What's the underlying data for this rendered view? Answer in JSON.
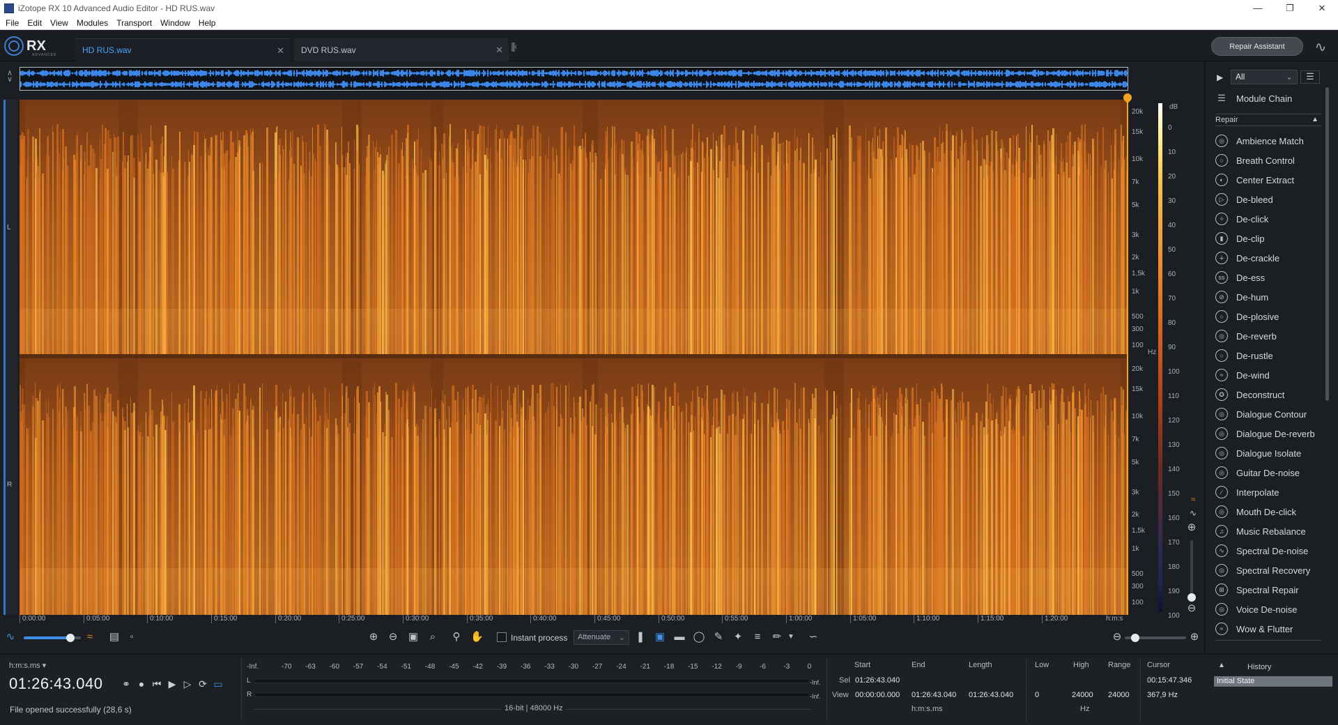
{
  "window": {
    "title": "iZotope RX 10 Advanced Audio Editor - HD RUS.wav"
  },
  "menu": [
    "File",
    "Edit",
    "View",
    "Modules",
    "Transport",
    "Window",
    "Help"
  ],
  "logo": {
    "text": "RX",
    "sub": "ADVANCED"
  },
  "tabs": [
    {
      "label": "HD RUS.wav",
      "active": true
    },
    {
      "label": "DVD RUS.wav",
      "active": false
    }
  ],
  "repair_assistant_label": "Repair Assistant",
  "channels": {
    "left": "L",
    "right": "R"
  },
  "freq_ticks": [
    "20k",
    "15k",
    "10k",
    "7k",
    "5k",
    "3k",
    "2k",
    "1,5k",
    "1k",
    "500",
    "300",
    "100"
  ],
  "freq_unit": "Hz",
  "db_unit": "dB",
  "db_ticks": [
    "0",
    "10",
    "20",
    "30",
    "40",
    "50",
    "60",
    "70",
    "80",
    "90",
    "100",
    "110",
    "120",
    "130",
    "140",
    "150",
    "160",
    "170",
    "180",
    "190",
    "100"
  ],
  "time_ticks": [
    "0:00:00",
    "0:05:00",
    "0:10:00",
    "0:15:00",
    "0:20:00",
    "0:25:00",
    "0:30:00",
    "0:35:00",
    "0:40:00",
    "0:45:00",
    "0:50:00",
    "0:55:00",
    "1:00:00",
    "1:05:00",
    "1:10:00",
    "1:15:00",
    "1:20:00"
  ],
  "time_unit": "h:m:s",
  "toolbar": {
    "instant_process_label": "Instant process",
    "attenuate_label": "Attenuate",
    "volume_level": 0.82,
    "zoom_level": 0.1
  },
  "transport": {
    "time_format": "h:m:s.ms",
    "timecode": "01:26:43.040",
    "status": "File opened successfully (28,6 s)"
  },
  "meter": {
    "scale": [
      "-Inf.",
      "-70",
      "-63",
      "-60",
      "-57",
      "-54",
      "-51",
      "-48",
      "-45",
      "-42",
      "-39",
      "-36",
      "-33",
      "-30",
      "-27",
      "-24",
      "-21",
      "-18",
      "-15",
      "-12",
      "-9",
      "-6",
      "-3",
      "0"
    ],
    "left_label": "L",
    "right_label": "R",
    "left_value": "-Inf.",
    "right_value": "-Inf.",
    "format": "16-bit | 48000 Hz"
  },
  "selection": {
    "headers": {
      "start": "Start",
      "end": "End",
      "length": "Length"
    },
    "sel_label": "Sel",
    "view_label": "View",
    "sel_start": "01:26:43.040",
    "view_start": "00:00:00.000",
    "view_end": "01:26:43.040",
    "view_length": "01:26:43.040",
    "unit": "h:m:s.ms"
  },
  "frequency": {
    "headers": {
      "low": "Low",
      "high": "High",
      "range": "Range"
    },
    "low": "0",
    "high": "24000",
    "range": "24000",
    "unit": "Hz"
  },
  "cursor": {
    "header": "Cursor",
    "time": "00:15:47.346",
    "freq": "367,9 Hz"
  },
  "sidebar": {
    "filter": "All",
    "module_chain": "Module Chain",
    "section": "Repair",
    "modules": [
      "Ambience Match",
      "Breath Control",
      "Center Extract",
      "De-bleed",
      "De-click",
      "De-clip",
      "De-crackle",
      "De-ess",
      "De-hum",
      "De-plosive",
      "De-reverb",
      "De-rustle",
      "De-wind",
      "Deconstruct",
      "Dialogue Contour",
      "Dialogue De-reverb",
      "Dialogue Isolate",
      "Guitar De-noise",
      "Interpolate",
      "Mouth De-click",
      "Music Rebalance",
      "Spectral De-noise",
      "Spectral Recovery",
      "Spectral Repair",
      "Voice De-noise",
      "Wow & Flutter"
    ]
  },
  "history": {
    "title": "History",
    "items": [
      "Initial State"
    ]
  },
  "colors": {
    "accent": "#3e8fe8",
    "playhead": "#f2a321",
    "spectrogram_base": "#7a3c15"
  }
}
